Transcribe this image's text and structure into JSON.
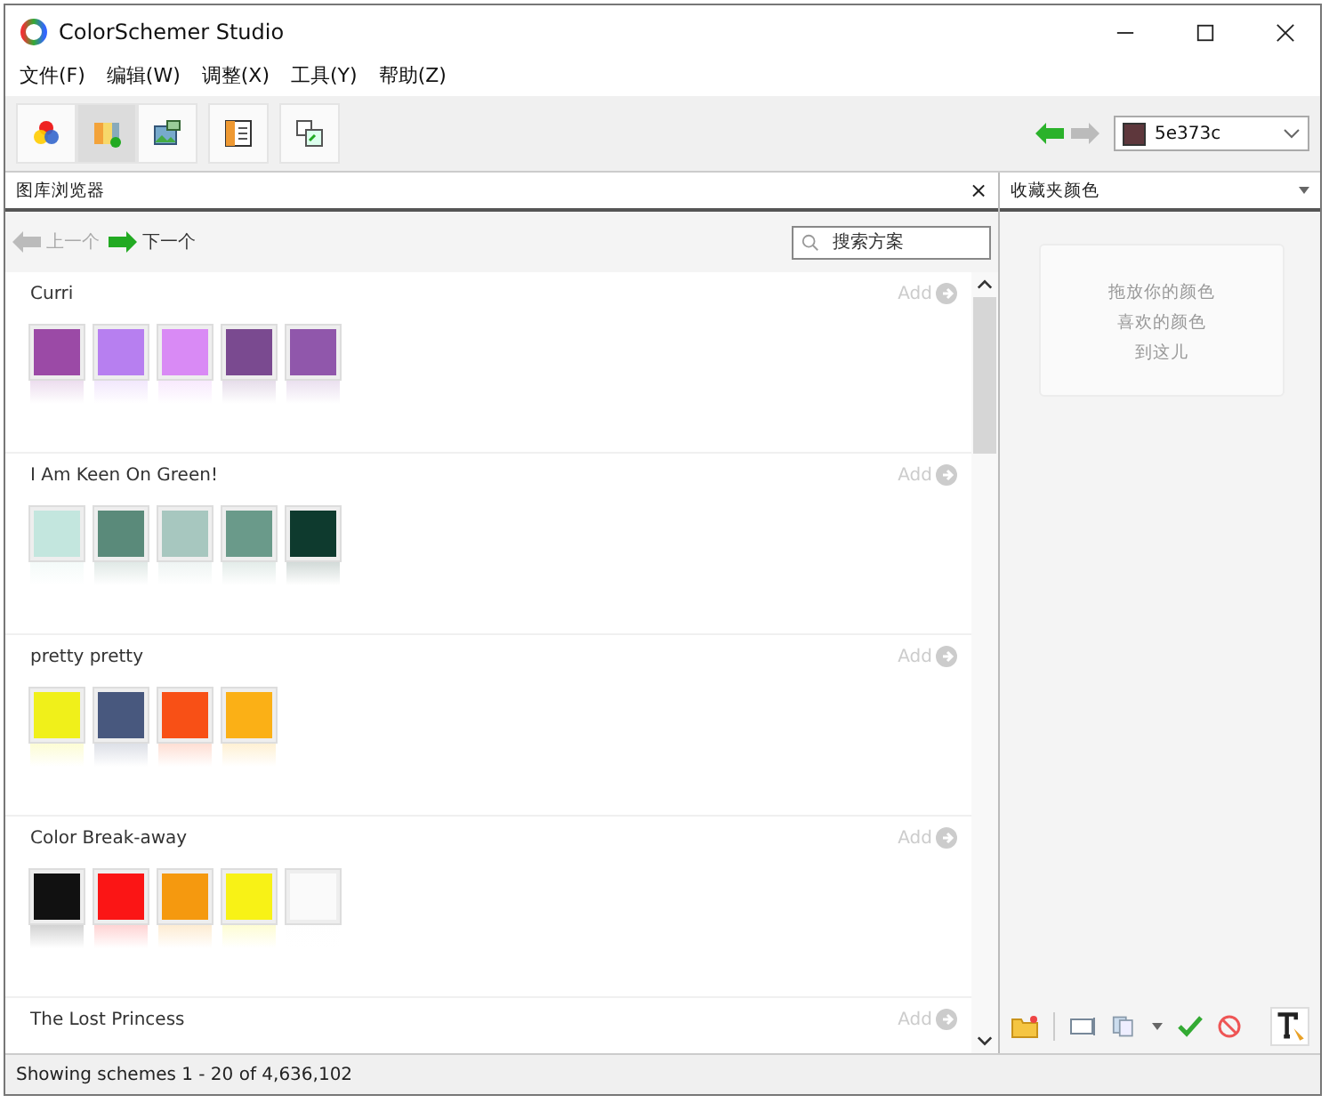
{
  "window": {
    "title": "ColorSchemer Studio"
  },
  "menu": [
    "文件(F)",
    "编辑(W)",
    "调整(X)",
    "工具(Y)",
    "帮助(Z)"
  ],
  "toolbar": [
    {
      "kind": "wheel",
      "selected": false
    },
    {
      "kind": "browser",
      "selected": true
    },
    {
      "kind": "image",
      "selected": false
    },
    {
      "kind": "gallery",
      "selected": false
    },
    {
      "kind": "convert",
      "selected": false
    }
  ],
  "color_field": {
    "value": "5e373c",
    "color": "#5e373c"
  },
  "browser": {
    "title": "图库浏览器",
    "close": "×",
    "prev": "上一个",
    "next": "下一个",
    "search": {
      "placeholder": "搜索方案"
    },
    "schemes": [
      {
        "name": "Curri",
        "add": "Add",
        "swatches": [
          {
            "color": "#9b4aa6"
          },
          {
            "color": "#b77ff0"
          },
          {
            "color": "#d98af5"
          },
          {
            "color": "#7a4a90"
          },
          {
            "color": "#9057ab"
          }
        ]
      },
      {
        "name": "I Am Keen On Green!",
        "add": "Add",
        "swatches": [
          {
            "color": "#c3e6de"
          },
          {
            "color": "#5a8a7a"
          },
          {
            "color": "#a7c7bf"
          },
          {
            "color": "#6a9a8a"
          },
          {
            "color": "#0e3a2e"
          }
        ]
      },
      {
        "name": "pretty pretty",
        "add": "Add",
        "swatches": [
          {
            "color": "#f0f01a"
          },
          {
            "color": "#48587e"
          },
          {
            "color": "#f85016"
          },
          {
            "color": "#fbb016"
          }
        ]
      },
      {
        "name": "Color Break-away",
        "add": "Add",
        "swatches": [
          {
            "color": "#111111"
          },
          {
            "color": "#fb1515"
          },
          {
            "color": "#f5990f"
          },
          {
            "color": "#f8f216"
          },
          {
            "color": "#fafafa"
          }
        ]
      },
      {
        "name": "The Lost Princess",
        "add": "Add"
      }
    ]
  },
  "favorites": {
    "title": "收藏夹颜色",
    "drop_hint": [
      "拖放你的颜色",
      "喜欢的颜色",
      "到这儿"
    ]
  },
  "status_bar": "Showing schemes 1 - 20 of 4,636,102"
}
